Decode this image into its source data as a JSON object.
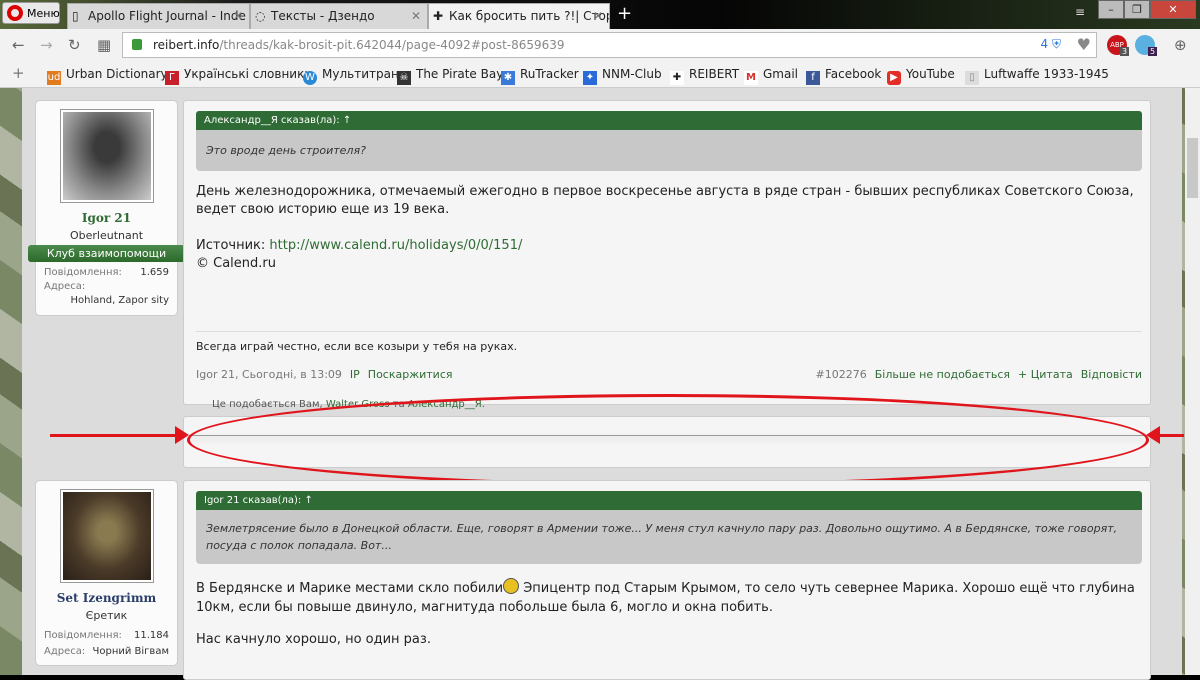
{
  "browser": {
    "menu_label": "Меню",
    "tabs": [
      {
        "title": "Apollo Flight Journal - Inde"
      },
      {
        "title": "Тексты - Дзендо"
      },
      {
        "title": "Как бросить пить ?!| Сторі"
      }
    ],
    "url_host": "reibert.info",
    "url_path": "/threads/kak-brosit-pit.642044/page-4092#post-8659639",
    "tracker_count": "4",
    "abp_badge": "3",
    "ghost_badge": "5",
    "bookmarks": [
      {
        "label": "Urban Dictionary",
        "icon": "ud",
        "color": "#e27b1e"
      },
      {
        "label": "Українські словники",
        "icon": "Г",
        "color": "#c8202a"
      },
      {
        "label": "Мультитран",
        "icon": "W",
        "color": "#2a8ad8"
      },
      {
        "label": "The Pirate Bay",
        "icon": "☠",
        "color": "#333333"
      },
      {
        "label": "RuTracker",
        "icon": "✱",
        "color": "#3a7ad8"
      },
      {
        "label": "NNM-Club",
        "icon": "✦",
        "color": "#2a6ad8"
      },
      {
        "label": "REIBERT",
        "icon": "✚",
        "color": "#222222"
      },
      {
        "label": "Gmail",
        "icon": "M",
        "color": "#d8302a"
      },
      {
        "label": "Facebook",
        "icon": "f",
        "color": "#3b5998"
      },
      {
        "label": "YouTube",
        "icon": "▶",
        "color": "#e52d27"
      },
      {
        "label": "Luftwaffe 1933-1945",
        "icon": "▯",
        "color": "#aaaaaa"
      }
    ]
  },
  "posts": [
    {
      "user": {
        "name": "Igor 21",
        "title": "Oberleutnant",
        "banner": "Клуб взаимопомощи",
        "stats": [
          {
            "label": "Повідомлення:",
            "value": "1.659"
          },
          {
            "label": "Адреса:",
            "value": "Hohland, Zapor sity"
          }
        ]
      },
      "quote_head": "Александр__Я сказав(ла): ↑",
      "quote": "Это вроде день строителя?",
      "body": [
        "День железнодорожника, отмечаемый ежегодно в первое воскресенье августа в ряде стран - бывших республиках Советского Союза, ведет свою историю еще из 19 века."
      ],
      "source_label": "Источник: ",
      "source_link": "http://www.calend.ru/holidays/0/0/151/",
      "copyright": "© Calend.ru",
      "signature": "Всегда играй честно, если все козыри у тебя на руках.",
      "meta": "Igor 21, Сьогодні, в 13:09",
      "ip": "IP",
      "report": "Поскаржитися",
      "number": "#102276",
      "unlike": "Більше не подобається",
      "quote_btn": "+ Цитата",
      "reply": "Відповісти",
      "likes_prefix": "Це подобається Вам, ",
      "likes_user1": "Walter Gross",
      "likes_mid": " та ",
      "likes_user2": "Александр__Я",
      "likes_suffix": "."
    },
    {
      "user": {
        "name": "Set Izengrimm",
        "title": "Єретик",
        "stats": [
          {
            "label": "Повідомлення:",
            "value": "11.184"
          },
          {
            "label": "Адреса:",
            "value": "Чорний Вігвам"
          }
        ]
      },
      "quote_head": "Igor 21 сказав(ла): ↑",
      "quote": "Землетрясение было в Донецкой области. Еще, говорят в Армении тоже... У меня стул качнуло пару раз. Довольно ощутимо. А в Бердянске, тоже говорят, посуда с полок попадала. Вот...",
      "body1a": "В Бердянске и Марике местами скло побили",
      "body1b": " Эпицентр под Старым Крымом, то село чуть севернее Марика. Хорошо ещё что глубина 10км, если бы повыше двинуло, магнитуда побольше была 6, могло и окна побить.",
      "body2": "Нас качнуло хорошо, но один раз."
    }
  ]
}
